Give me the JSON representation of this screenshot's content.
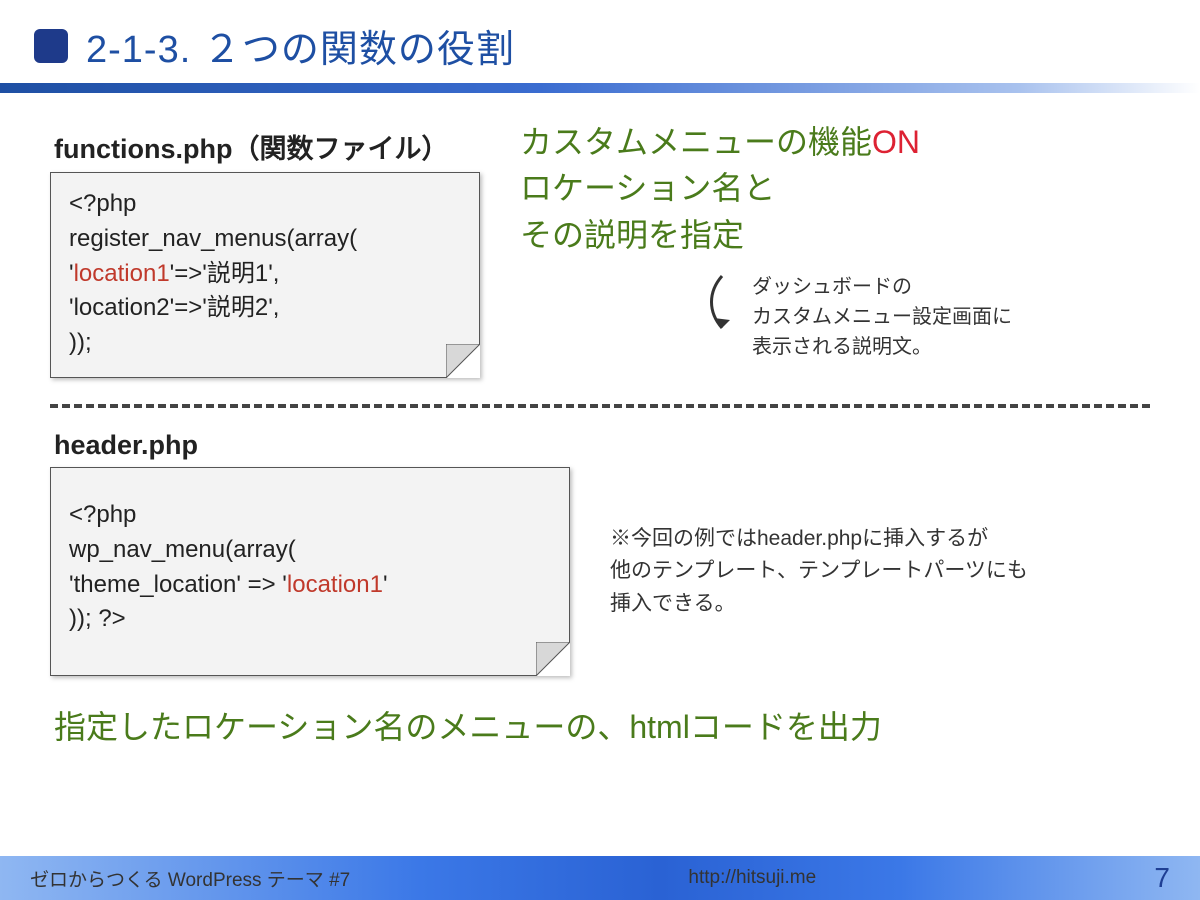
{
  "title": "2-1-3.  ２つの関数の役割",
  "file1_label": "functions.php（関数ファイル）",
  "code1": {
    "l1": "<?php",
    "l2": "register_nav_menus(array(",
    "l3a": "        '",
    "l3b": "location1",
    "l3c": "'=>'説明1',",
    "l4": "        'location2'=>'説明2',",
    "l5": "));"
  },
  "green1_a": "カスタムメニューの機能",
  "green1_on": "ON",
  "green1_b": "ロケーション名と",
  "green1_c": "その説明を指定",
  "small_note_l1": "ダッシュボードの",
  "small_note_l2": "カスタムメニュー設定画面に",
  "small_note_l3": "表示される説明文。",
  "file2_label": "header.php",
  "code2": {
    "l1": "<?php",
    "l2": "wp_nav_menu(array(",
    "l3a": "        'theme_location' => '",
    "l3b": "location1",
    "l3c": "'",
    "l4": ")); ?>"
  },
  "row2_note_l1": "※今回の例ではheader.phpに挿入するが",
  "row2_note_l2": "他のテンプレート、テンプレートパーツにも",
  "row2_note_l3": "挿入できる。",
  "bottom_green": "指定したロケーション名のメニューの、htmlコードを出力",
  "footer_left": "ゼロからつくる WordPress テーマ #7",
  "footer_mid": "http://hitsuji.me",
  "footer_page": "7"
}
